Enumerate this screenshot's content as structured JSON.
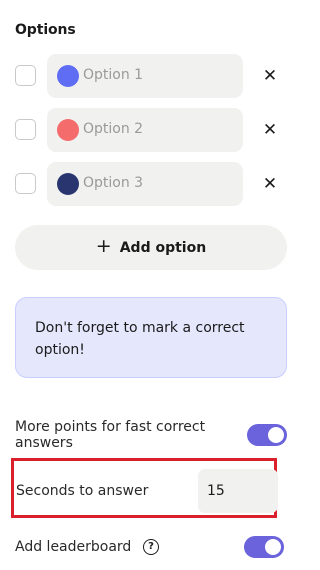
{
  "section": {
    "title": "Options"
  },
  "options": [
    {
      "label": "Option 1",
      "color": "#5f6cf4"
    },
    {
      "label": "Option 2",
      "color": "#f46c6c"
    },
    {
      "label": "Option 3",
      "color": "#28356f"
    }
  ],
  "add_option": {
    "label": "Add option",
    "icon": "plus-icon"
  },
  "notice": {
    "text": "Don't forget to mark a correct option!",
    "background": "#e5e8fd"
  },
  "settings": {
    "fast_points": {
      "label": "More points for fast correct answers",
      "enabled": true
    },
    "seconds": {
      "label": "Seconds to answer",
      "value": "15"
    },
    "leaderboard": {
      "label": "Add leaderboard",
      "enabled": true,
      "help_icon": "question-circle-icon"
    }
  },
  "colors": {
    "accent_toggle": "#6b63db",
    "highlight": "#d9202c"
  }
}
